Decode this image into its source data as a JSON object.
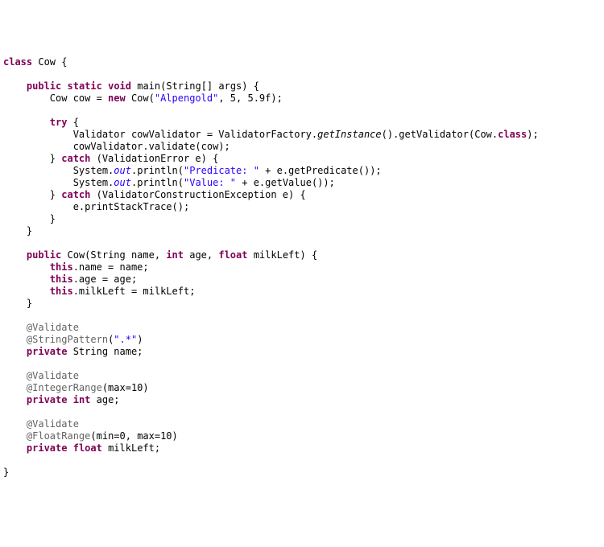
{
  "code": {
    "l01": {
      "kw1": "class",
      "t1": " Cow {"
    },
    "l03": {
      "i": "    ",
      "kw1": "public",
      "sp1": " ",
      "kw2": "static",
      "sp2": " ",
      "kw3": "void",
      "t1": " main(String[] args) {"
    },
    "l04": {
      "t1": "        Cow cow = ",
      "kw1": "new",
      "t2": " Cow(",
      "str1": "\"Alpengold\"",
      "t3": ", 5, 5.9f);"
    },
    "l06": {
      "i": "        ",
      "kw1": "try",
      "t1": " {"
    },
    "l07": {
      "t1": "            Validator cowValidator = ValidatorFactory.",
      "m1": "getInstance",
      "t2": "().getValidator(Cow.",
      "kw1": "class",
      "t3": ");"
    },
    "l08": {
      "t1": "            cowValidator.validate(cow);"
    },
    "l09": {
      "t1": "        } ",
      "kw1": "catch",
      "t2": " (ValidationError e) {"
    },
    "l10": {
      "t1": "            System.",
      "f1": "out",
      "t2": ".println(",
      "str1": "\"Predicate: \"",
      "t3": " + e.getPredicate());"
    },
    "l11": {
      "t1": "            System.",
      "f1": "out",
      "t2": ".println(",
      "str1": "\"Value: \"",
      "t3": " + e.getValue());"
    },
    "l12": {
      "t1": "        } ",
      "kw1": "catch",
      "t2": " (ValidatorConstructionException e) {"
    },
    "l13": {
      "t1": "            e.printStackTrace();"
    },
    "l14": {
      "t1": "        }"
    },
    "l15": {
      "t1": "    }"
    },
    "l17": {
      "i": "    ",
      "kw1": "public",
      "t1": " Cow(String name, ",
      "kw2": "int",
      "t2": " age, ",
      "kw3": "float",
      "t3": " milkLeft) {"
    },
    "l18": {
      "i": "        ",
      "kw1": "this",
      "t1": ".name = name;"
    },
    "l19": {
      "i": "        ",
      "kw1": "this",
      "t1": ".age = age;"
    },
    "l20": {
      "i": "        ",
      "kw1": "this",
      "t1": ".milkLeft = milkLeft;"
    },
    "l21": {
      "t1": "    }"
    },
    "l23": {
      "i": "    ",
      "ann1": "@Validate"
    },
    "l24": {
      "i": "    ",
      "ann1": "@StringPattern",
      "t1": "(",
      "str1": "\".*\"",
      "t2": ")"
    },
    "l25": {
      "i": "    ",
      "kw1": "private",
      "t1": " String name;"
    },
    "l27": {
      "i": "    ",
      "ann1": "@Validate"
    },
    "l28": {
      "i": "    ",
      "ann1": "@IntegerRange",
      "t1": "(max=10)"
    },
    "l29": {
      "i": "    ",
      "kw1": "private",
      "sp": " ",
      "kw2": "int",
      "t1": " age;"
    },
    "l31": {
      "i": "    ",
      "ann1": "@Validate"
    },
    "l32": {
      "i": "    ",
      "ann1": "@FloatRange",
      "t1": "(min=0, max=10)"
    },
    "l33": {
      "i": "    ",
      "kw1": "private",
      "sp": " ",
      "kw2": "float",
      "t1": " milkLeft;"
    },
    "l35": {
      "t1": "}"
    }
  }
}
